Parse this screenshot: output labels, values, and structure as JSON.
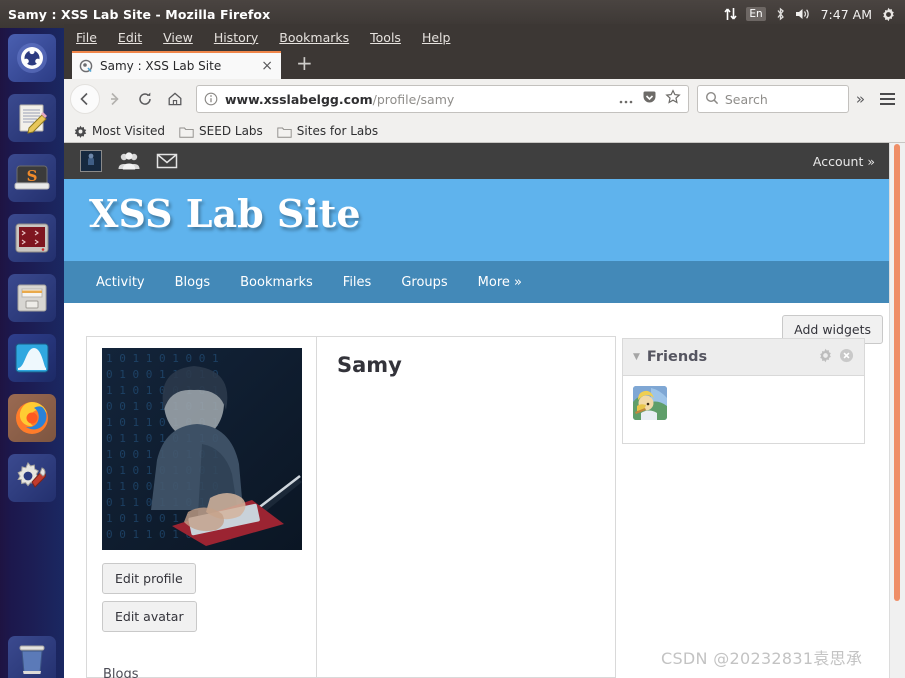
{
  "window": {
    "title": "Samy : XSS Lab Site - Mozilla Firefox"
  },
  "tray": {
    "network_icon": "network-updown-icon",
    "keyboard_layout": "En",
    "bluetooth_icon": "bluetooth-icon",
    "volume_icon": "volume-icon",
    "clock": "7:47 AM",
    "settings_icon": "gear-icon"
  },
  "launcher": {
    "items": [
      {
        "name": "ubuntu-dash",
        "label": "Ubuntu Dash"
      },
      {
        "name": "text-editor",
        "label": "Text Editor"
      },
      {
        "name": "sublime-drive",
        "label": "S Drive"
      },
      {
        "name": "terminal",
        "label": "Terminal"
      },
      {
        "name": "file-manager",
        "label": "Files"
      },
      {
        "name": "wireshark",
        "label": "Wireshark"
      },
      {
        "name": "firefox",
        "label": "Firefox"
      },
      {
        "name": "system-settings",
        "label": "System Settings"
      },
      {
        "name": "trash",
        "label": "Trash"
      }
    ]
  },
  "menubar": {
    "items": [
      "File",
      "Edit",
      "View",
      "History",
      "Bookmarks",
      "Tools",
      "Help"
    ]
  },
  "browser": {
    "tab": {
      "title": "Samy : XSS Lab Site",
      "favicon": "elgg-favicon",
      "close_label": "×",
      "new_tab_label": "+"
    },
    "nav": {
      "back_label": "←",
      "forward_label": "→",
      "reload_label": "↻",
      "home_label": "home-icon"
    },
    "url": {
      "info_icon": "info-icon",
      "domain": "www.xsslabelgg.com",
      "path": "/profile/samy",
      "page_actions_icon": "ellipsis-icon",
      "pocket_icon": "pocket-icon",
      "bookmark_icon": "star-icon"
    },
    "search": {
      "icon": "search-icon",
      "placeholder": "Search"
    },
    "overflow_label": "»",
    "menu_icon": "hamburger-icon",
    "bookmarks": [
      {
        "icon": "most-visited-icon",
        "label": "Most Visited"
      },
      {
        "icon": "folder-icon",
        "label": "SEED Labs"
      },
      {
        "icon": "folder-icon",
        "label": "Sites for Labs"
      }
    ]
  },
  "site": {
    "topbar": {
      "avatar_icon": "user-avatar-thumb",
      "friends_icon": "people-icon",
      "messages_icon": "envelope-icon",
      "account_label": "Account  »"
    },
    "title": "XSS Lab Site",
    "nav": [
      {
        "label": "Activity"
      },
      {
        "label": "Blogs"
      },
      {
        "label": "Bookmarks"
      },
      {
        "label": "Files"
      },
      {
        "label": "Groups"
      },
      {
        "label": "More  »"
      }
    ],
    "add_widgets_label": "Add widgets",
    "profile": {
      "name": "Samy",
      "avatar_icon": "profile-avatar-hacker",
      "edit_profile_label": "Edit profile",
      "edit_avatar_label": "Edit avatar",
      "blogs_label": "Blogs"
    },
    "friends_widget": {
      "caret_icon": "caret-down-icon",
      "title": "Friends",
      "settings_icon": "gear-icon",
      "close_icon": "close-circle-icon",
      "friend_avatar_icon": "friend-avatar-alice"
    }
  },
  "watermark": "CSDN @20232831袁思承",
  "colors": {
    "panel": "#3c3734",
    "launcher": "#1f2a63",
    "site_header": "#5fb3ed",
    "site_nav": "#4389b8",
    "tab_accent": "#f0864a",
    "scrollbar": "#ef8e67"
  }
}
